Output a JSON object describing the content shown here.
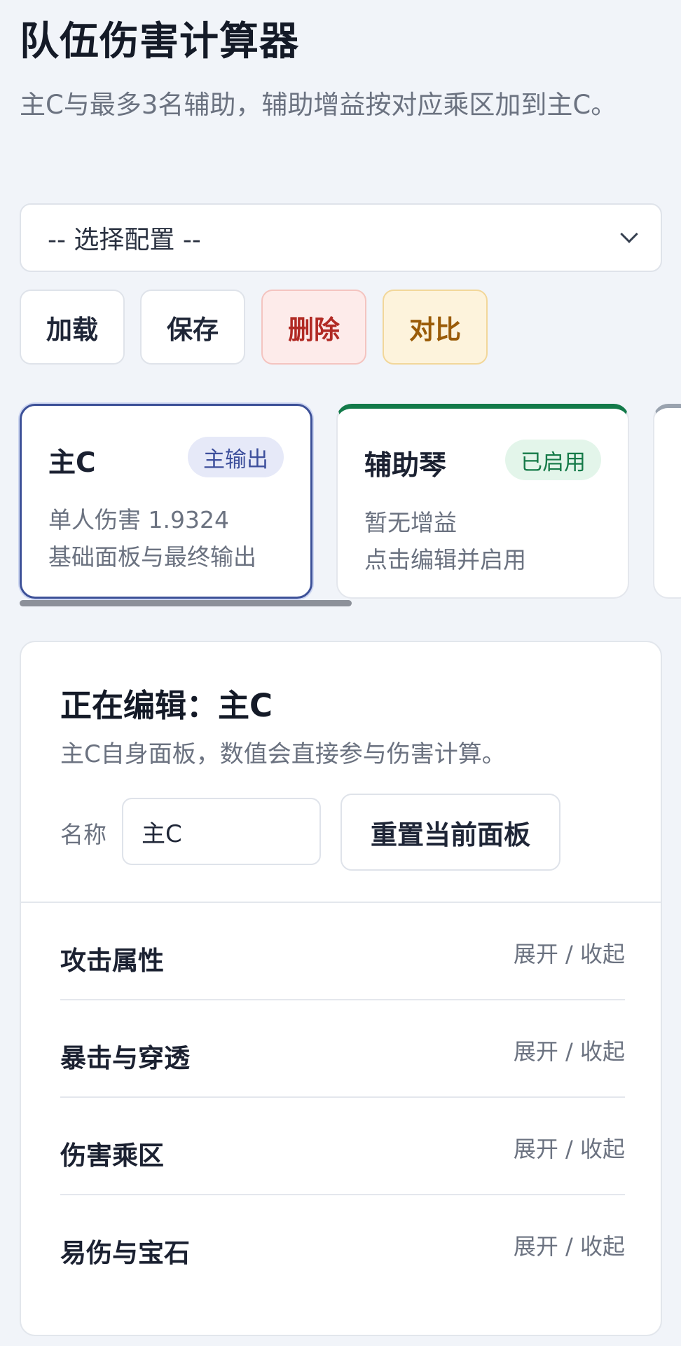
{
  "header": {
    "title": "队伍伤害计算器",
    "description": "主C与最多3名辅助，辅助增益按对应乘区加到主C。"
  },
  "config_select": {
    "selected": "-- 选择配置 --"
  },
  "actions": {
    "load": "加载",
    "save": "保存",
    "delete": "删除",
    "compare": "对比"
  },
  "cards": [
    {
      "name": "主C",
      "badge": "主输出",
      "line1": "单人伤害 1.9324",
      "line2": "基础面板与最终输出"
    },
    {
      "name": "辅助琴",
      "badge": "已启用",
      "line1": "暂无增益",
      "line2": "点击编辑并启用"
    }
  ],
  "editor": {
    "title": "正在编辑：主C",
    "description": "主C自身面板，数值会直接参与伤害计算。",
    "name_label": "名称",
    "name_value": "主C",
    "reset_label": "重置当前面板",
    "sections": [
      {
        "title": "攻击属性",
        "toggle": "展开 / 收起"
      },
      {
        "title": "暴击与穿透",
        "toggle": "展开 / 收起"
      },
      {
        "title": "伤害乘区",
        "toggle": "展开 / 收起"
      },
      {
        "title": "易伤与宝石",
        "toggle": "展开 / 收起"
      }
    ]
  },
  "colors": {
    "main_accent": "#3d5198",
    "support_accent": "#137a4a",
    "delete_text": "#b12a24",
    "compare_text": "#9a5b07"
  }
}
